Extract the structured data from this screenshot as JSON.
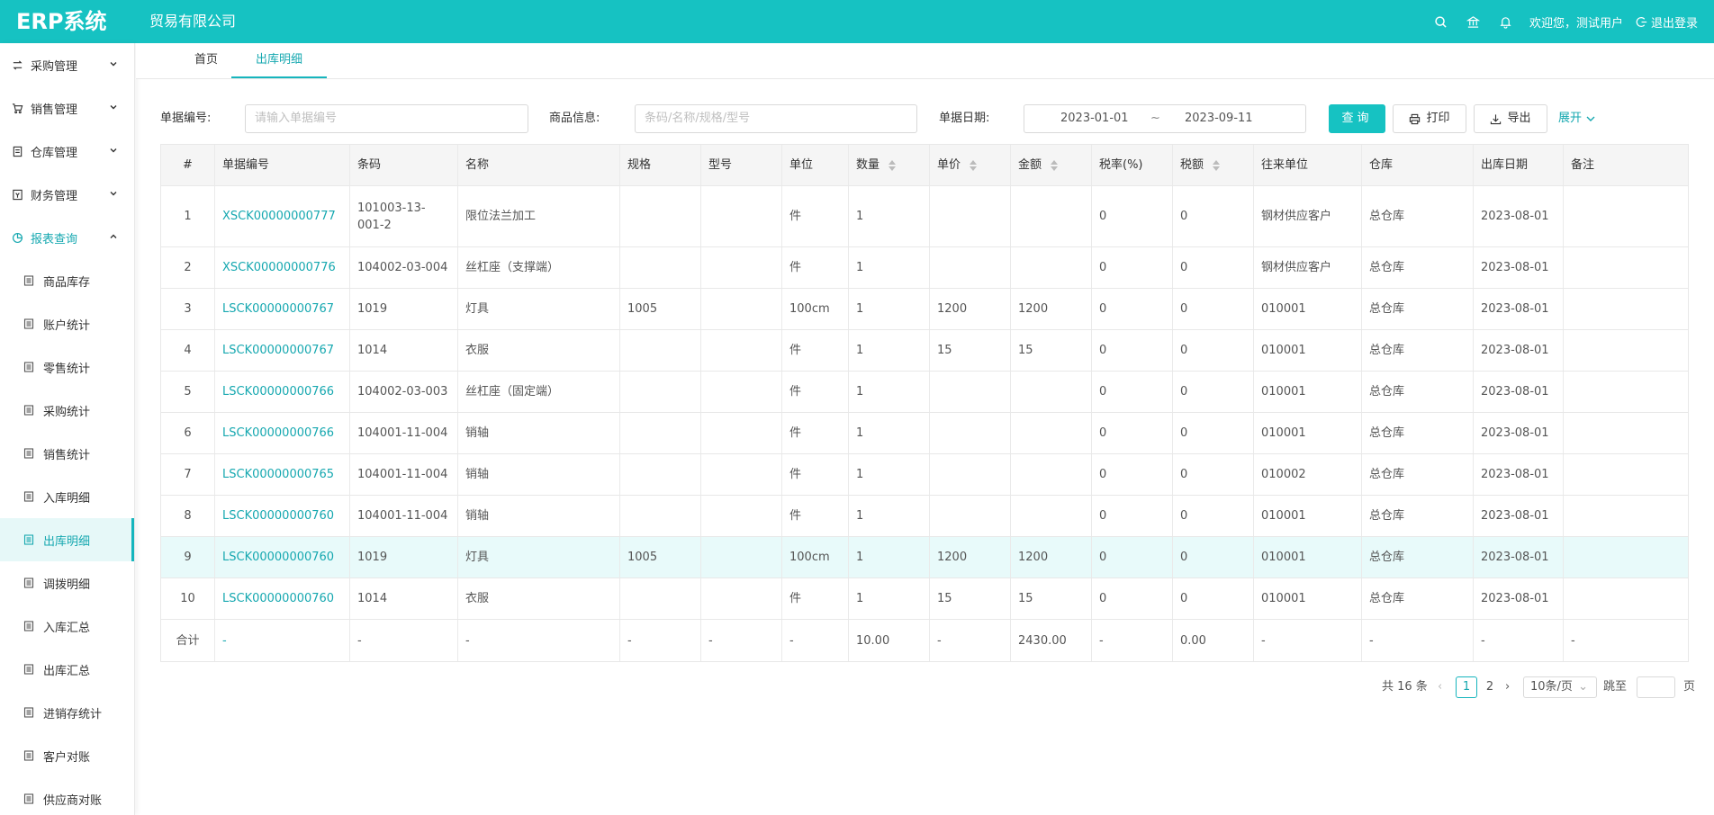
{
  "header": {
    "logo": "ERP系统",
    "company": "贸易有限公司",
    "welcome": "欢迎您，测试用户",
    "logout": "退出登录"
  },
  "sidebar": {
    "groups": [
      {
        "label": "采购管理"
      },
      {
        "label": "销售管理"
      },
      {
        "label": "仓库管理"
      },
      {
        "label": "财务管理"
      },
      {
        "label": "报表查询"
      }
    ],
    "report_items": [
      {
        "label": "商品库存"
      },
      {
        "label": "账户统计"
      },
      {
        "label": "零售统计"
      },
      {
        "label": "采购统计"
      },
      {
        "label": "销售统计"
      },
      {
        "label": "入库明细"
      },
      {
        "label": "出库明细"
      },
      {
        "label": "调拨明细"
      },
      {
        "label": "入库汇总"
      },
      {
        "label": "出库汇总"
      },
      {
        "label": "进销存统计"
      },
      {
        "label": "客户对账"
      },
      {
        "label": "供应商对账"
      }
    ]
  },
  "tabs": [
    {
      "label": "首页"
    },
    {
      "label": "出库明细"
    }
  ],
  "filters": {
    "order_no_label": "单据编号:",
    "order_no_placeholder": "请输入单据编号",
    "goods_label": "商品信息:",
    "goods_placeholder": "条码/名称/规格/型号",
    "date_label": "单据日期:",
    "date_start": "2023-01-01",
    "date_sep": "~",
    "date_end": "2023-09-11",
    "query_button": "查询",
    "print_button": "打印",
    "export_button": "导出",
    "expand_link": "展开"
  },
  "table": {
    "columns": [
      "#",
      "单据编号",
      "条码",
      "名称",
      "规格",
      "型号",
      "单位",
      "数量",
      "单价",
      "金额",
      "税率(%)",
      "税额",
      "往来单位",
      "仓库",
      "出库日期",
      "备注"
    ],
    "rows": [
      [
        "1",
        "XSCK00000000777",
        "101003-13-001-2",
        "限位法兰加工",
        "",
        "",
        "件",
        "1",
        "",
        "",
        "0",
        "0",
        "钢材供应客户",
        "总仓库",
        "2023-08-01",
        ""
      ],
      [
        "2",
        "XSCK00000000776",
        "104002-03-004",
        "丝杠座（支撑端）",
        "",
        "",
        "件",
        "1",
        "",
        "",
        "0",
        "0",
        "钢材供应客户",
        "总仓库",
        "2023-08-01",
        ""
      ],
      [
        "3",
        "LSCK00000000767",
        "1019",
        "灯具",
        "1005",
        "",
        "100cm",
        "1",
        "1200",
        "1200",
        "0",
        "0",
        "010001",
        "总仓库",
        "2023-08-01",
        ""
      ],
      [
        "4",
        "LSCK00000000767",
        "1014",
        "衣服",
        "",
        "",
        "件",
        "1",
        "15",
        "15",
        "0",
        "0",
        "010001",
        "总仓库",
        "2023-08-01",
        ""
      ],
      [
        "5",
        "LSCK00000000766",
        "104002-03-003",
        "丝杠座（固定端）",
        "",
        "",
        "件",
        "1",
        "",
        "",
        "0",
        "0",
        "010001",
        "总仓库",
        "2023-08-01",
        ""
      ],
      [
        "6",
        "LSCK00000000766",
        "104001-11-004",
        "销轴",
        "",
        "",
        "件",
        "1",
        "",
        "",
        "0",
        "0",
        "010001",
        "总仓库",
        "2023-08-01",
        ""
      ],
      [
        "7",
        "LSCK00000000765",
        "104001-11-004",
        "销轴",
        "",
        "",
        "件",
        "1",
        "",
        "",
        "0",
        "0",
        "010002",
        "总仓库",
        "2023-08-01",
        ""
      ],
      [
        "8",
        "LSCK00000000760",
        "104001-11-004",
        "销轴",
        "",
        "",
        "件",
        "1",
        "",
        "",
        "0",
        "0",
        "010001",
        "总仓库",
        "2023-08-01",
        ""
      ],
      [
        "9",
        "LSCK00000000760",
        "1019",
        "灯具",
        "1005",
        "",
        "100cm",
        "1",
        "1200",
        "1200",
        "0",
        "0",
        "010001",
        "总仓库",
        "2023-08-01",
        ""
      ],
      [
        "10",
        "LSCK00000000760",
        "1014",
        "衣服",
        "",
        "",
        "件",
        "1",
        "15",
        "15",
        "0",
        "0",
        "010001",
        "总仓库",
        "2023-08-01",
        ""
      ]
    ],
    "summary": [
      "合计",
      "-",
      "-",
      "-",
      "-",
      "-",
      "-",
      "10.00",
      "-",
      "2430.00",
      "-",
      "0.00",
      "-",
      "-",
      "-",
      "-"
    ]
  },
  "pagination": {
    "total": "共 16 条",
    "pages": [
      "1",
      "2"
    ],
    "current": "1",
    "page_size": "10条/页",
    "jump_label": "跳至",
    "page_suffix": "页"
  },
  "colors": {
    "primary": "#16c2c2",
    "link": "#16a8b0",
    "highlight_row": "#e8fafa"
  }
}
